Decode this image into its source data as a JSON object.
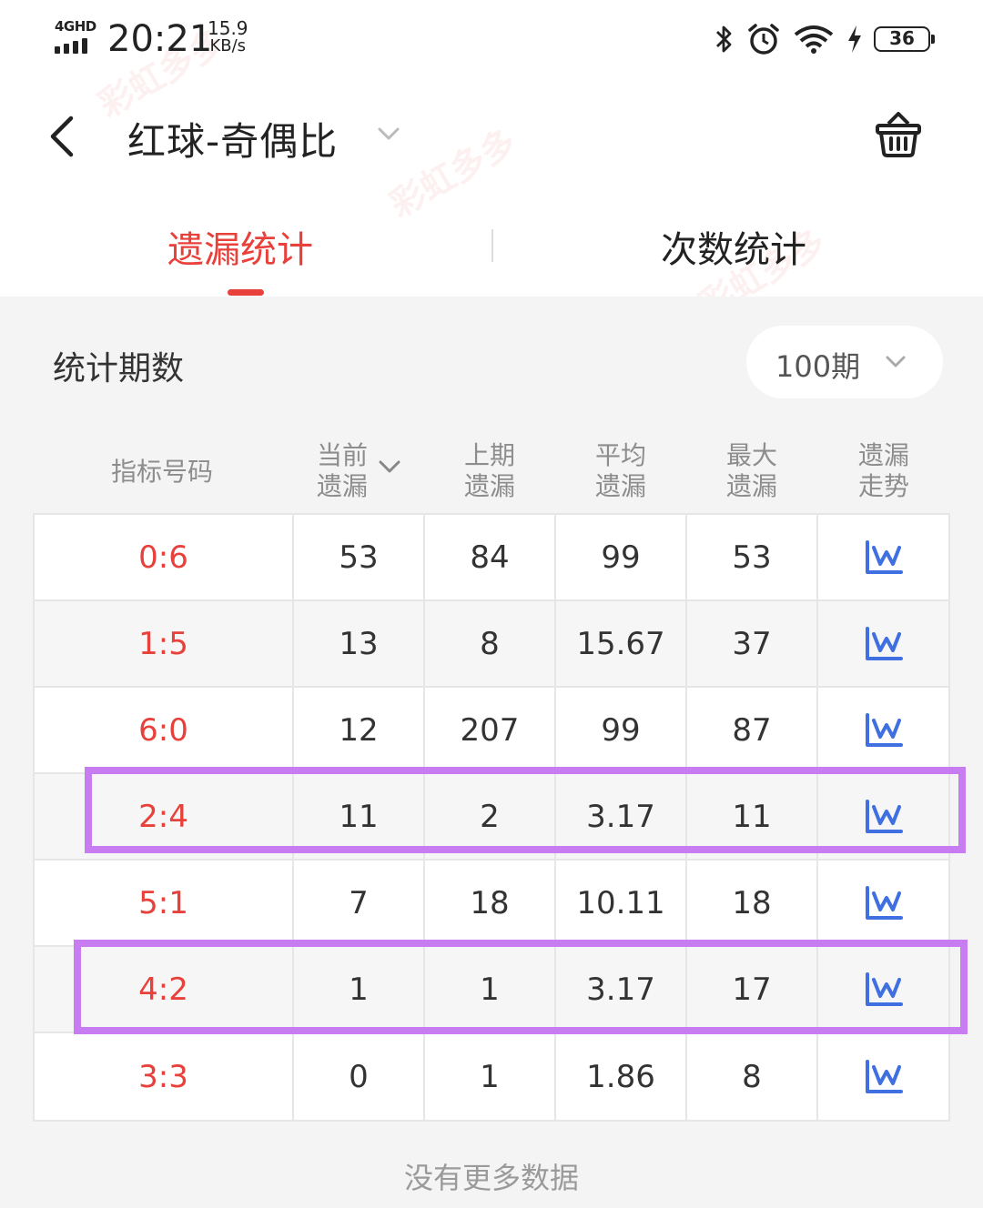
{
  "status_bar": {
    "network_type": "4GHD",
    "time": "20:21",
    "speed_value": "15.9",
    "speed_unit": "KB/s",
    "battery_level": "36"
  },
  "header": {
    "title": "红球-奇偶比"
  },
  "tabs": [
    {
      "label": "遗漏统计",
      "active": true
    },
    {
      "label": "次数统计",
      "active": false
    }
  ],
  "period": {
    "label": "统计期数",
    "selected": "100期"
  },
  "table": {
    "headers": [
      [
        "指标号码"
      ],
      [
        "当前",
        "遗漏"
      ],
      [
        "上期",
        "遗漏"
      ],
      [
        "平均",
        "遗漏"
      ],
      [
        "最大",
        "遗漏"
      ],
      [
        "遗漏",
        "走势"
      ]
    ],
    "rows": [
      {
        "label": "0:6",
        "current": "53",
        "last": "84",
        "avg": "99",
        "max": "53"
      },
      {
        "label": "1:5",
        "current": "13",
        "last": "8",
        "avg": "15.67",
        "max": "37"
      },
      {
        "label": "6:0",
        "current": "12",
        "last": "207",
        "avg": "99",
        "max": "87"
      },
      {
        "label": "2:4",
        "current": "11",
        "last": "2",
        "avg": "3.17",
        "max": "11"
      },
      {
        "label": "5:1",
        "current": "7",
        "last": "18",
        "avg": "10.11",
        "max": "18"
      },
      {
        "label": "4:2",
        "current": "1",
        "last": "1",
        "avg": "3.17",
        "max": "17"
      },
      {
        "label": "3:3",
        "current": "0",
        "last": "1",
        "avg": "1.86",
        "max": "8"
      }
    ]
  },
  "footer": {
    "no_more": "没有更多数据"
  },
  "watermark": "彩虹多多",
  "colors": {
    "accent": "#e8403a",
    "highlight": "#c77cf2",
    "trend_icon": "#3f6fe0"
  }
}
